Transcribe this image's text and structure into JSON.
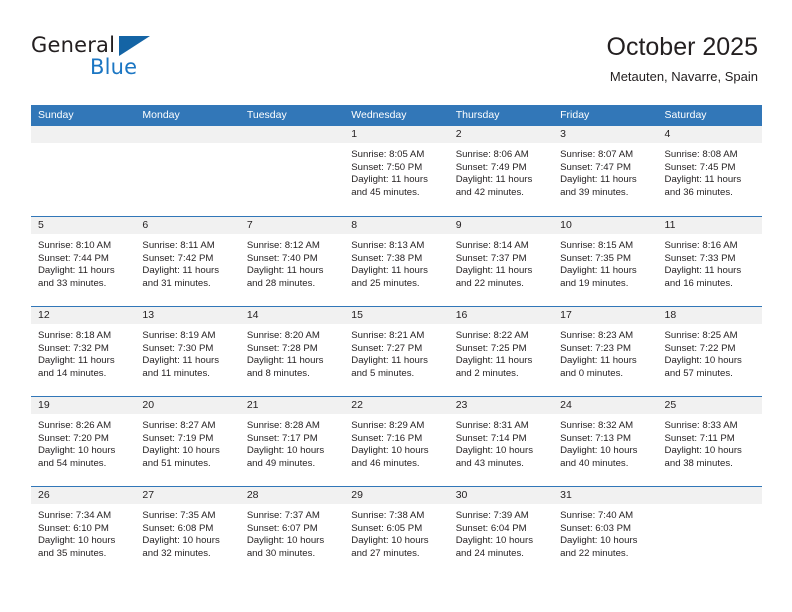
{
  "brand": {
    "name_part1": "General",
    "name_part2": "Blue",
    "logo_icon": "triangle-logo-icon"
  },
  "header": {
    "title": "October 2025",
    "subtitle": "Metauten, Navarre, Spain"
  },
  "calendar": {
    "accent_color": "#3277b8",
    "day_header_bg": "#f1f1f1",
    "weekdays": [
      "Sunday",
      "Monday",
      "Tuesday",
      "Wednesday",
      "Thursday",
      "Friday",
      "Saturday"
    ],
    "weeks": [
      [
        {
          "empty": true
        },
        {
          "empty": true
        },
        {
          "empty": true
        },
        {
          "day": "1",
          "sunrise": "Sunrise: 8:05 AM",
          "sunset": "Sunset: 7:50 PM",
          "daylight_line1": "Daylight: 11 hours",
          "daylight_line2": "and 45 minutes."
        },
        {
          "day": "2",
          "sunrise": "Sunrise: 8:06 AM",
          "sunset": "Sunset: 7:49 PM",
          "daylight_line1": "Daylight: 11 hours",
          "daylight_line2": "and 42 minutes."
        },
        {
          "day": "3",
          "sunrise": "Sunrise: 8:07 AM",
          "sunset": "Sunset: 7:47 PM",
          "daylight_line1": "Daylight: 11 hours",
          "daylight_line2": "and 39 minutes."
        },
        {
          "day": "4",
          "sunrise": "Sunrise: 8:08 AM",
          "sunset": "Sunset: 7:45 PM",
          "daylight_line1": "Daylight: 11 hours",
          "daylight_line2": "and 36 minutes."
        }
      ],
      [
        {
          "day": "5",
          "sunrise": "Sunrise: 8:10 AM",
          "sunset": "Sunset: 7:44 PM",
          "daylight_line1": "Daylight: 11 hours",
          "daylight_line2": "and 33 minutes."
        },
        {
          "day": "6",
          "sunrise": "Sunrise: 8:11 AM",
          "sunset": "Sunset: 7:42 PM",
          "daylight_line1": "Daylight: 11 hours",
          "daylight_line2": "and 31 minutes."
        },
        {
          "day": "7",
          "sunrise": "Sunrise: 8:12 AM",
          "sunset": "Sunset: 7:40 PM",
          "daylight_line1": "Daylight: 11 hours",
          "daylight_line2": "and 28 minutes."
        },
        {
          "day": "8",
          "sunrise": "Sunrise: 8:13 AM",
          "sunset": "Sunset: 7:38 PM",
          "daylight_line1": "Daylight: 11 hours",
          "daylight_line2": "and 25 minutes."
        },
        {
          "day": "9",
          "sunrise": "Sunrise: 8:14 AM",
          "sunset": "Sunset: 7:37 PM",
          "daylight_line1": "Daylight: 11 hours",
          "daylight_line2": "and 22 minutes."
        },
        {
          "day": "10",
          "sunrise": "Sunrise: 8:15 AM",
          "sunset": "Sunset: 7:35 PM",
          "daylight_line1": "Daylight: 11 hours",
          "daylight_line2": "and 19 minutes."
        },
        {
          "day": "11",
          "sunrise": "Sunrise: 8:16 AM",
          "sunset": "Sunset: 7:33 PM",
          "daylight_line1": "Daylight: 11 hours",
          "daylight_line2": "and 16 minutes."
        }
      ],
      [
        {
          "day": "12",
          "sunrise": "Sunrise: 8:18 AM",
          "sunset": "Sunset: 7:32 PM",
          "daylight_line1": "Daylight: 11 hours",
          "daylight_line2": "and 14 minutes."
        },
        {
          "day": "13",
          "sunrise": "Sunrise: 8:19 AM",
          "sunset": "Sunset: 7:30 PM",
          "daylight_line1": "Daylight: 11 hours",
          "daylight_line2": "and 11 minutes."
        },
        {
          "day": "14",
          "sunrise": "Sunrise: 8:20 AM",
          "sunset": "Sunset: 7:28 PM",
          "daylight_line1": "Daylight: 11 hours",
          "daylight_line2": "and 8 minutes."
        },
        {
          "day": "15",
          "sunrise": "Sunrise: 8:21 AM",
          "sunset": "Sunset: 7:27 PM",
          "daylight_line1": "Daylight: 11 hours",
          "daylight_line2": "and 5 minutes."
        },
        {
          "day": "16",
          "sunrise": "Sunrise: 8:22 AM",
          "sunset": "Sunset: 7:25 PM",
          "daylight_line1": "Daylight: 11 hours",
          "daylight_line2": "and 2 minutes."
        },
        {
          "day": "17",
          "sunrise": "Sunrise: 8:23 AM",
          "sunset": "Sunset: 7:23 PM",
          "daylight_line1": "Daylight: 11 hours",
          "daylight_line2": "and 0 minutes."
        },
        {
          "day": "18",
          "sunrise": "Sunrise: 8:25 AM",
          "sunset": "Sunset: 7:22 PM",
          "daylight_line1": "Daylight: 10 hours",
          "daylight_line2": "and 57 minutes."
        }
      ],
      [
        {
          "day": "19",
          "sunrise": "Sunrise: 8:26 AM",
          "sunset": "Sunset: 7:20 PM",
          "daylight_line1": "Daylight: 10 hours",
          "daylight_line2": "and 54 minutes."
        },
        {
          "day": "20",
          "sunrise": "Sunrise: 8:27 AM",
          "sunset": "Sunset: 7:19 PM",
          "daylight_line1": "Daylight: 10 hours",
          "daylight_line2": "and 51 minutes."
        },
        {
          "day": "21",
          "sunrise": "Sunrise: 8:28 AM",
          "sunset": "Sunset: 7:17 PM",
          "daylight_line1": "Daylight: 10 hours",
          "daylight_line2": "and 49 minutes."
        },
        {
          "day": "22",
          "sunrise": "Sunrise: 8:29 AM",
          "sunset": "Sunset: 7:16 PM",
          "daylight_line1": "Daylight: 10 hours",
          "daylight_line2": "and 46 minutes."
        },
        {
          "day": "23",
          "sunrise": "Sunrise: 8:31 AM",
          "sunset": "Sunset: 7:14 PM",
          "daylight_line1": "Daylight: 10 hours",
          "daylight_line2": "and 43 minutes."
        },
        {
          "day": "24",
          "sunrise": "Sunrise: 8:32 AM",
          "sunset": "Sunset: 7:13 PM",
          "daylight_line1": "Daylight: 10 hours",
          "daylight_line2": "and 40 minutes."
        },
        {
          "day": "25",
          "sunrise": "Sunrise: 8:33 AM",
          "sunset": "Sunset: 7:11 PM",
          "daylight_line1": "Daylight: 10 hours",
          "daylight_line2": "and 38 minutes."
        }
      ],
      [
        {
          "day": "26",
          "sunrise": "Sunrise: 7:34 AM",
          "sunset": "Sunset: 6:10 PM",
          "daylight_line1": "Daylight: 10 hours",
          "daylight_line2": "and 35 minutes."
        },
        {
          "day": "27",
          "sunrise": "Sunrise: 7:35 AM",
          "sunset": "Sunset: 6:08 PM",
          "daylight_line1": "Daylight: 10 hours",
          "daylight_line2": "and 32 minutes."
        },
        {
          "day": "28",
          "sunrise": "Sunrise: 7:37 AM",
          "sunset": "Sunset: 6:07 PM",
          "daylight_line1": "Daylight: 10 hours",
          "daylight_line2": "and 30 minutes."
        },
        {
          "day": "29",
          "sunrise": "Sunrise: 7:38 AM",
          "sunset": "Sunset: 6:05 PM",
          "daylight_line1": "Daylight: 10 hours",
          "daylight_line2": "and 27 minutes."
        },
        {
          "day": "30",
          "sunrise": "Sunrise: 7:39 AM",
          "sunset": "Sunset: 6:04 PM",
          "daylight_line1": "Daylight: 10 hours",
          "daylight_line2": "and 24 minutes."
        },
        {
          "day": "31",
          "sunrise": "Sunrise: 7:40 AM",
          "sunset": "Sunset: 6:03 PM",
          "daylight_line1": "Daylight: 10 hours",
          "daylight_line2": "and 22 minutes."
        },
        {
          "empty": true
        }
      ]
    ]
  }
}
